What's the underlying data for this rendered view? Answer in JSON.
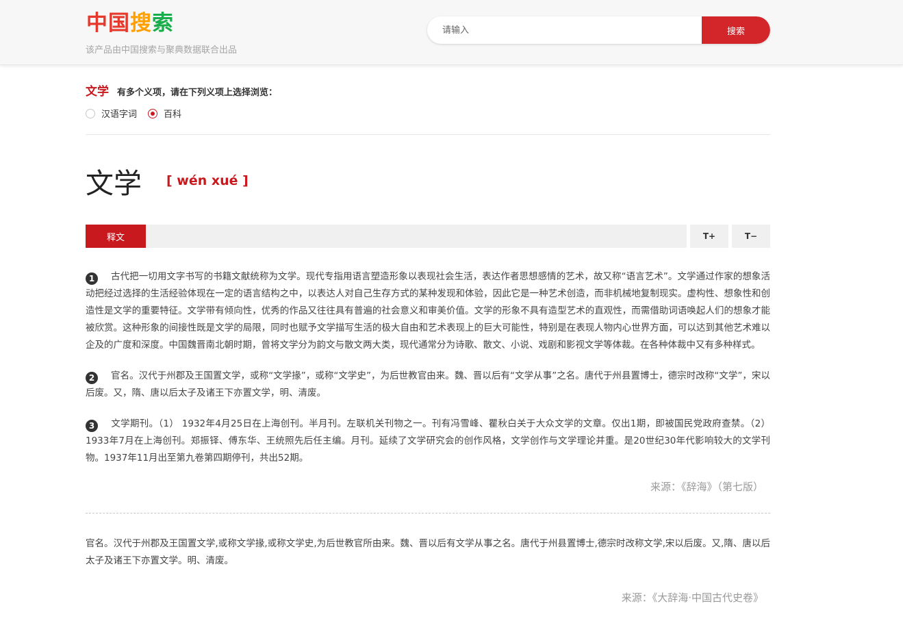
{
  "header": {
    "logo": {
      "part1": "中国",
      "part2": "搜",
      "part3": "索"
    },
    "tagline": "该产品由中国搜索与聚典数据联合出品",
    "search_placeholder": "请输入",
    "search_button": "搜索"
  },
  "sense": {
    "word": "文学",
    "hint": "有多个义项，请在下列义项上选择浏览：",
    "options": [
      {
        "label": "汉语字词",
        "selected": false
      },
      {
        "label": "百科",
        "selected": true
      }
    ]
  },
  "entry": {
    "headword": "文学",
    "pinyin": "[ wén xué ]"
  },
  "tabs": {
    "active": "释文",
    "font_increase": "T+",
    "font_decrease": "T−"
  },
  "definitions": [
    {
      "num": "1",
      "text": "古代把一切用文字书写的书籍文献统称为文学。现代专指用语言塑造形象以表现社会生活，表达作者思想感情的艺术，故又称“语言艺术”。文学通过作家的想象活动把经过选择的生活经验体现在一定的语言结构之中，以表达人对自己生存方式的某种发现和体验，因此它是一种艺术创造，而非机械地复制现实。虚构性、想象性和创造性是文学的重要特征。文学带有倾向性，优秀的作品又往往具有普遍的社会意义和审美价值。文学的形象不具有造型艺术的直观性，而需借助词语唤起人们的想象才能被欣赏。这种形象的间接性既是文学的局限，同时也赋予文学描写生活的极大自由和艺术表现上的巨大可能性，特别是在表现人物内心世界方面，可以达到其他艺术难以企及的广度和深度。中国魏晋南北朝时期，曾将文学分为韵文与散文两大类，现代通常分为诗歌、散文、小说、戏剧和影视文学等体裁。在各种体裁中又有多种样式。"
    },
    {
      "num": "2",
      "text": "官名。汉代于州郡及王国置文学，或称“文学掾”，或称“文学史”，为后世教官由来。魏、晋以后有“文学从事”之名。唐代于州县置博士，德宗时改称“文学”，宋以后废。又，隋、唐以后太子及诸王下亦置文学，明、清废。"
    },
    {
      "num": "3",
      "text": "文学期刊。（1） 1932年4月25日在上海创刊。半月刊。左联机关刊物之一。刊有冯雪峰、瞿秋白关于大众文学的文章。仅出1期，即被国民党政府查禁。（2） 1933年7月在上海创刊。郑振铎、傅东华、王统照先后任主编。月刊。延续了文学研究会的创作风格，文学创作与文学理论并重。是20世纪30年代影响较大的文学刊物。1937年11月出至第九卷第四期停刊，共出52期。"
    }
  ],
  "source1": "来源：《辞海》（第七版）",
  "definition_extra": "官名。汉代于州郡及王国置文学,或称文学掾,或称文学史,为后世教官所由来。魏、晋以后有文学从事之名。唐代于州县置博士,德宗时改称文学,宋以后废。又,隋、唐以后太子及诸王下亦置文学。明、清废。",
  "source2": "来源：《大辞海·中国古代史卷》",
  "colors": {
    "accent": "#c8191f",
    "search_button": "#d3262b",
    "logo_red": "#e6392c",
    "logo_orange": "#ff9f00",
    "logo_green": "#1aad4b"
  }
}
